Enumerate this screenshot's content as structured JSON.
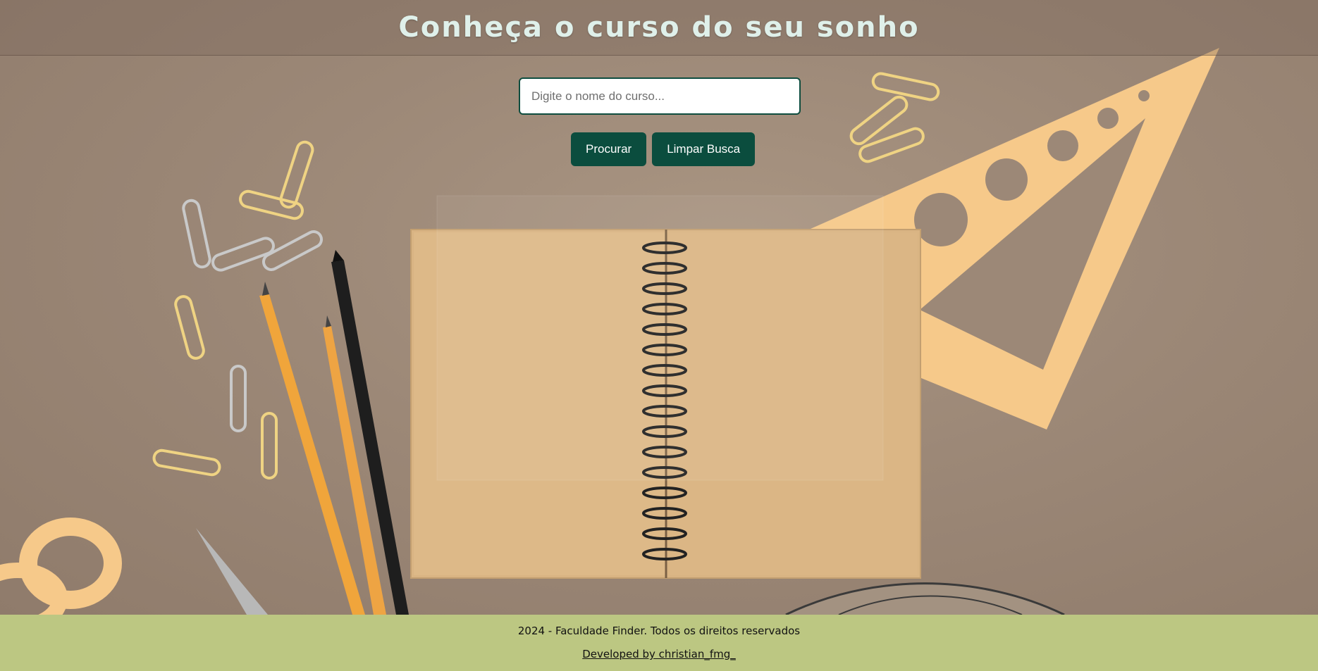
{
  "header": {
    "title": "Conheça o curso do seu sonho"
  },
  "search": {
    "placeholder": "Digite o nome do curso...",
    "value": ""
  },
  "buttons": {
    "search_label": "Procurar",
    "clear_label": "Limpar Busca"
  },
  "footer": {
    "copyright": "2024 - Faculdade Finder. Todos os direitos reservados",
    "developer_link": "Developed by christian_fmg_"
  },
  "colors": {
    "primary_button": "#0b4d3e",
    "footer_bg": "#bcc782",
    "title_text": "#dff0ea"
  }
}
